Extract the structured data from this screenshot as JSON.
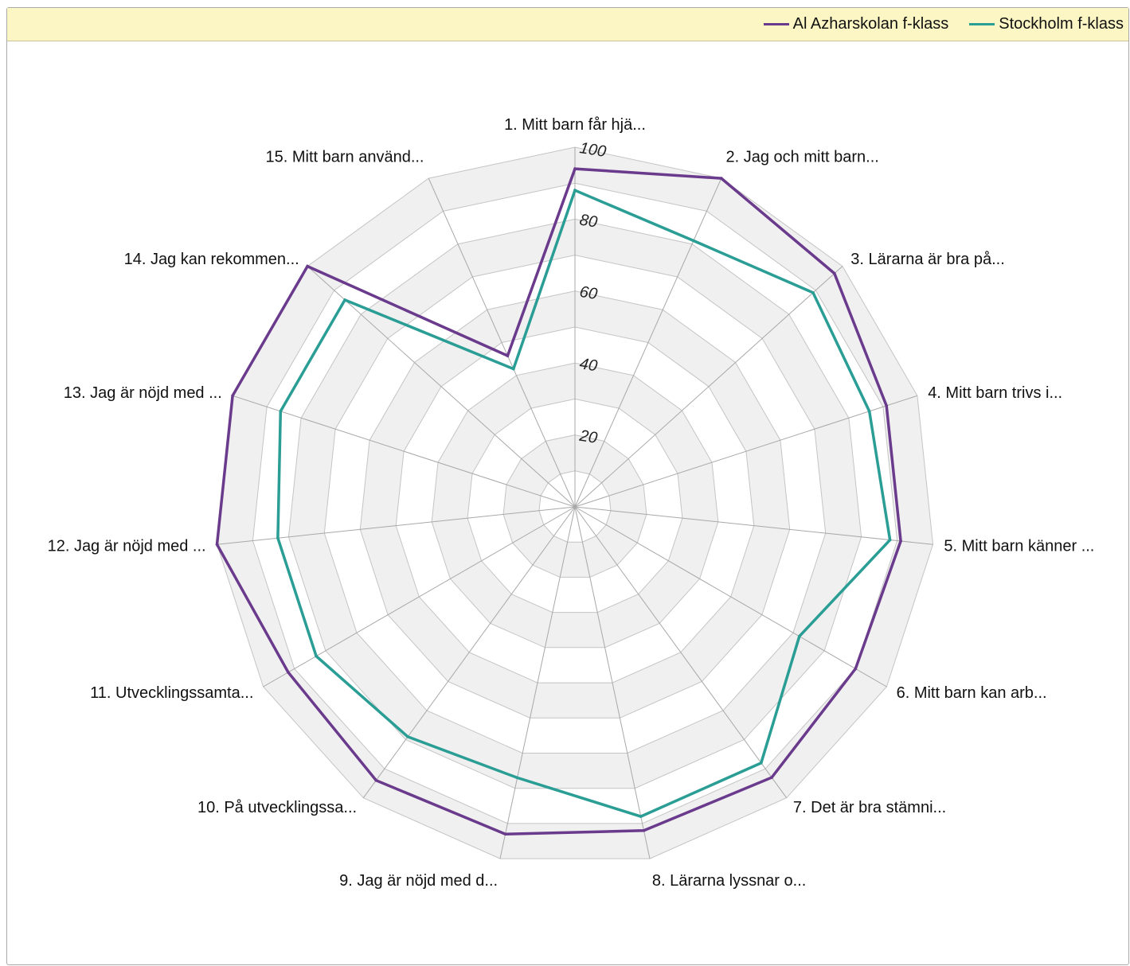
{
  "chart_data": {
    "type": "radar",
    "categories": [
      "1. Mitt barn får hjä...",
      "2. Jag och mitt barn...",
      "3. Lärarna är bra på...",
      "4. Mitt barn trivs i...",
      "5. Mitt barn känner ...",
      "6. Mitt barn kan arb...",
      "7. Det är bra stämni...",
      "8. Lärarna lyssnar o...",
      "9. Jag är nöjd med d...",
      "10. På utvecklingssa...",
      "11. Utvecklingssamta...",
      "12. Jag är nöjd med ...",
      "13. Jag är nöjd med ...",
      "14. Jag kan rekommen...",
      "15. Mitt barn använd..."
    ],
    "series": [
      {
        "name": "Al Azharskolan f-klass",
        "color": "#6a3a8c",
        "values": [
          94,
          100,
          97,
          91,
          91,
          90,
          93,
          92,
          93,
          94,
          92,
          100,
          100,
          100,
          46
        ]
      },
      {
        "name": "Stockholm f-klass",
        "color": "#2a9d95",
        "values": [
          88,
          81,
          89,
          86,
          88,
          72,
          88,
          88,
          77,
          79,
          83,
          83,
          86,
          86,
          42
        ]
      }
    ],
    "rlim": [
      0,
      100
    ],
    "ticks": [
      20,
      40,
      60,
      80,
      100
    ],
    "legend_position": "top-right",
    "grid": true
  }
}
